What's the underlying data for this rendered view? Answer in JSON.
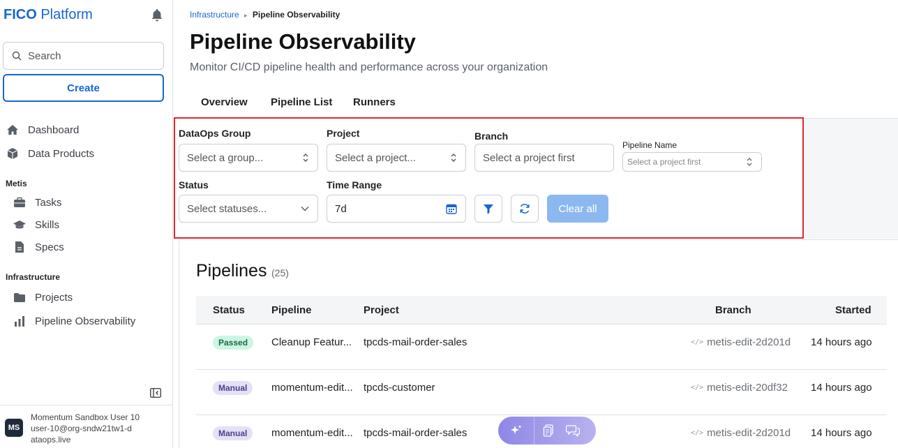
{
  "brand": {
    "bold": "FICO",
    "rest": "Platform"
  },
  "sidebar": {
    "search_placeholder": "Search",
    "create_label": "Create",
    "top_items": [
      {
        "label": "Dashboard",
        "icon": "home-icon"
      },
      {
        "label": "Data Products",
        "icon": "cube-icon"
      }
    ],
    "sections": [
      {
        "label": "Metis",
        "items": [
          {
            "label": "Tasks",
            "icon": "briefcase-icon"
          },
          {
            "label": "Skills",
            "icon": "graduation-cap-icon"
          },
          {
            "label": "Specs",
            "icon": "document-icon"
          }
        ]
      },
      {
        "label": "Infrastructure",
        "items": [
          {
            "label": "Projects",
            "icon": "folder-icon"
          },
          {
            "label": "Pipeline Observability",
            "icon": "bar-chart-icon"
          }
        ]
      }
    ],
    "user": {
      "initials": "MS",
      "name": "Momentum Sandbox User 10",
      "email": "user-10@org-sndw21tw1-dataops.live"
    }
  },
  "breadcrumb": {
    "parent": "Infrastructure",
    "separator": "▸",
    "current": "Pipeline Observability"
  },
  "page": {
    "title": "Pipeline Observability",
    "subtitle": "Monitor CI/CD pipeline health and performance across your organization"
  },
  "tabs": [
    "Overview",
    "Pipeline List",
    "Runners"
  ],
  "filters": {
    "dataops_group": {
      "label": "DataOps Group",
      "placeholder": "Select a group..."
    },
    "project": {
      "label": "Project",
      "placeholder": "Select a project..."
    },
    "branch": {
      "label": "Branch",
      "placeholder": "Select a project first"
    },
    "pipeline_name": {
      "label": "Pipeline Name",
      "placeholder": "Select a project first"
    },
    "status": {
      "label": "Status",
      "placeholder": "Select statuses..."
    },
    "time_range": {
      "label": "Time Range",
      "value": "7d"
    },
    "clear_all": "Clear all"
  },
  "pipelines": {
    "title": "Pipelines",
    "count": "(25)",
    "columns": {
      "status": "Status",
      "pipeline": "Pipeline",
      "project": "Project",
      "branch": "Branch",
      "started": "Started"
    },
    "rows": [
      {
        "status": "Passed",
        "pipeline": "Cleanup Featur...",
        "project": "tpcds-mail-order-sales",
        "branch": "metis-edit-2d201d",
        "started": "14 hours ago"
      },
      {
        "status": "Manual",
        "pipeline": "momentum-edit...",
        "project": "tpcds-customer",
        "branch": "metis-edit-20df32",
        "started": "14 hours ago"
      },
      {
        "status": "Manual",
        "pipeline": "momentum-edit...",
        "project": "tpcds-mail-order-sales",
        "branch": "metis-edit-2d201d",
        "started": "14 hours ago"
      }
    ]
  },
  "colors": {
    "brand": "#1766d1",
    "highlight_border": "#e0282e",
    "passed_bg": "#cdf5e4",
    "manual_bg": "#e3e0f7"
  }
}
